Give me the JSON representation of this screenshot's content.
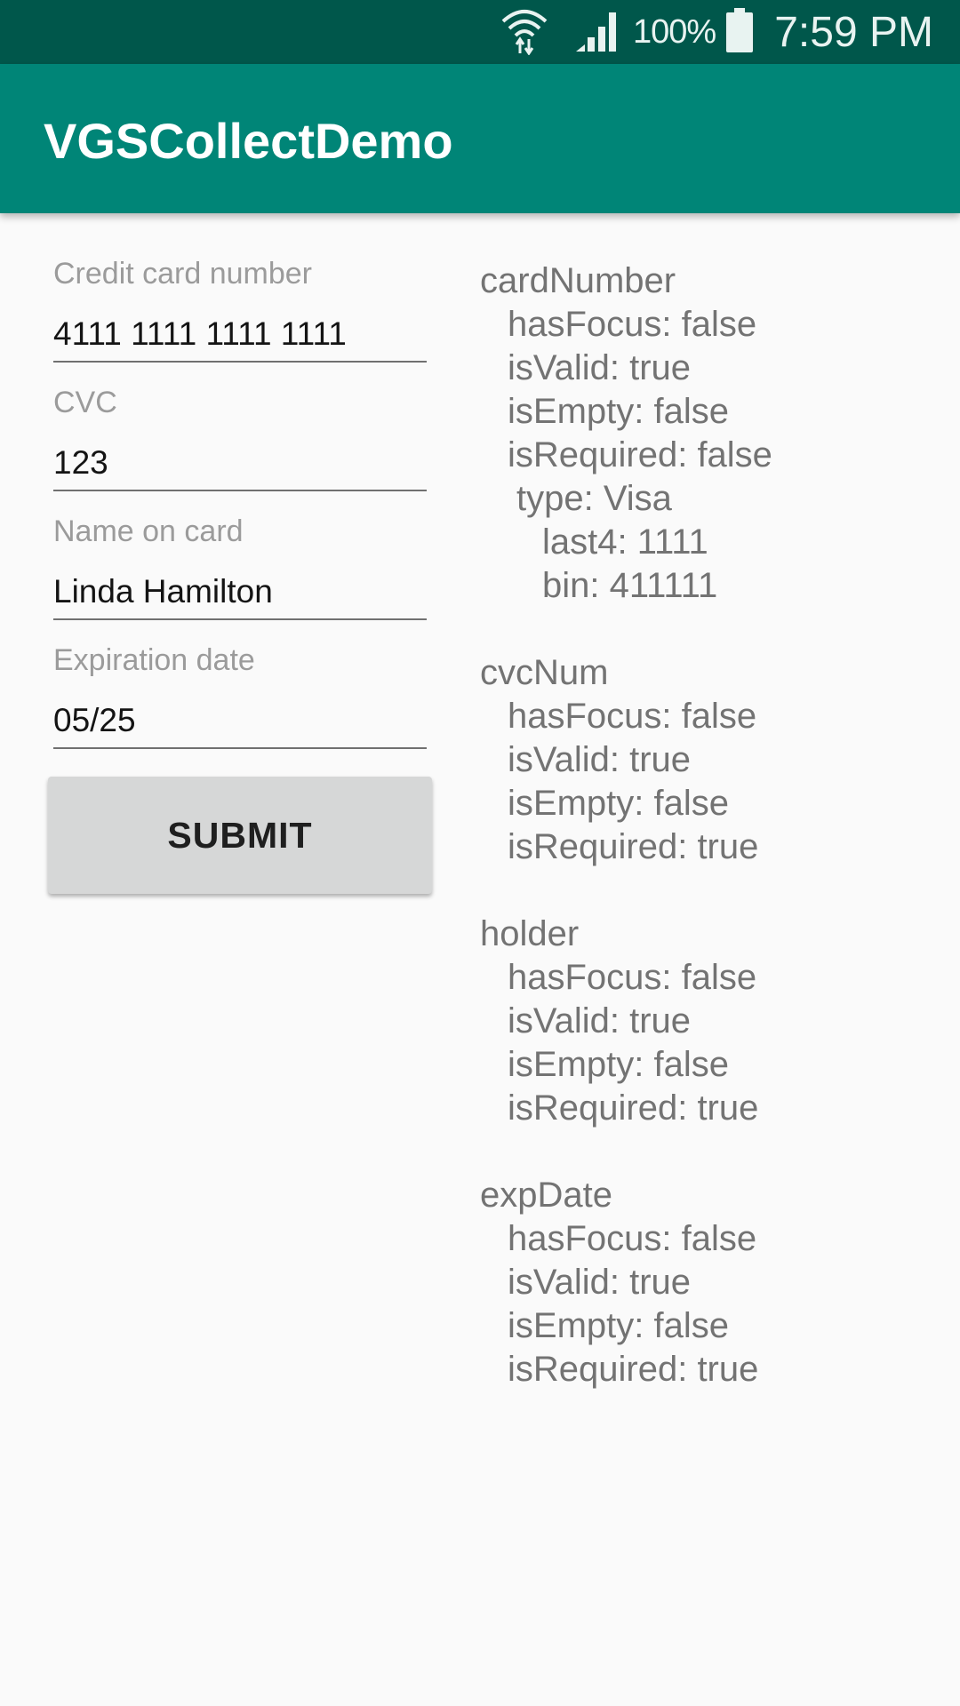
{
  "status_bar": {
    "battery_percent": "100%",
    "time": "7:59 PM",
    "background": "#00574b"
  },
  "app_bar": {
    "title": "VGSCollectDemo",
    "background": "#008577"
  },
  "form": {
    "fields": [
      {
        "label": "Credit card number",
        "value": "4111 1111 1111 1111"
      },
      {
        "label": "CVC",
        "value": "123"
      },
      {
        "label": "Name on card",
        "value": "Linda Hamilton"
      },
      {
        "label": "Expiration date",
        "value": "05/25"
      }
    ],
    "submit_label": "SUBMIT"
  },
  "state": {
    "card_number": {
      "title": "cardNumber",
      "has_focus": "hasFocus: false",
      "is_valid": "isValid: true",
      "is_empty": "isEmpty: false",
      "is_required": "isRequired: false",
      "type": "type: Visa",
      "last4": "last4: 1111",
      "bin": "bin: 411111"
    },
    "cvc_num": {
      "title": "cvcNum",
      "has_focus": "hasFocus: false",
      "is_valid": "isValid: true",
      "is_empty": "isEmpty: false",
      "is_required": "isRequired: true"
    },
    "holder": {
      "title": "holder",
      "has_focus": "hasFocus: false",
      "is_valid": "isValid: true",
      "is_empty": "isEmpty: false",
      "is_required": "isRequired: true"
    },
    "exp_date": {
      "title": "expDate",
      "has_focus": "hasFocus: false",
      "is_valid": "isValid: true",
      "is_empty": "isEmpty: false",
      "is_required": "isRequired: true"
    }
  }
}
